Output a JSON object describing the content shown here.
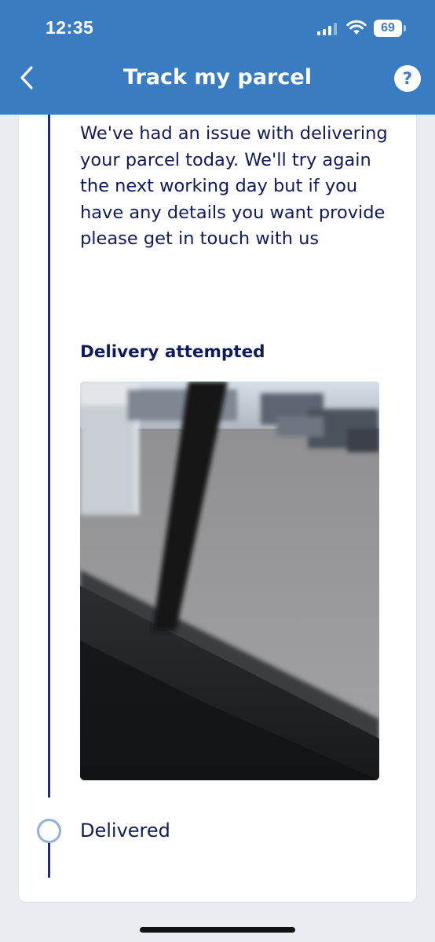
{
  "status_bar": {
    "time": "12:35",
    "battery_level": "69"
  },
  "header": {
    "title": "Track my parcel",
    "back_icon": "chevron-left-icon",
    "help_icon": "question-mark-icon",
    "help_label": "?",
    "background_color": "#3a7cc2"
  },
  "timeline": {
    "issue_message": "We've had an issue with delivering your parcel today. We'll try again the next working day but if you have any details you want provide please get in touch with us",
    "event_title": "Delivery attempted",
    "next_step_label": "Delivered",
    "line_color": "#1b2a8a",
    "text_color": "#101a5c"
  }
}
